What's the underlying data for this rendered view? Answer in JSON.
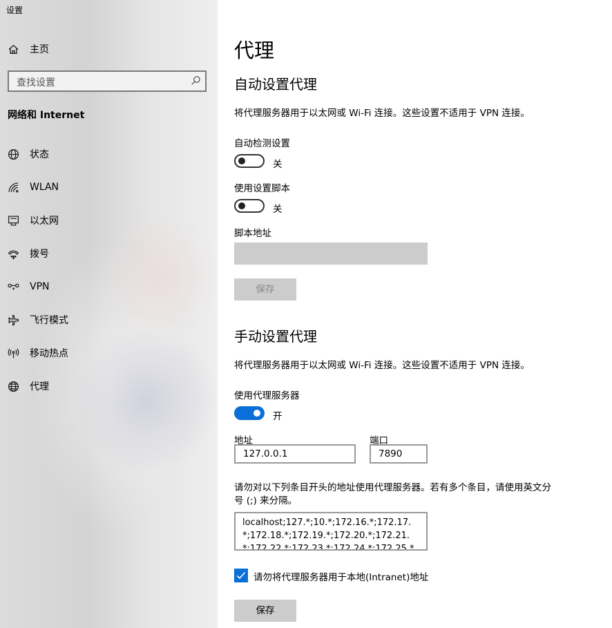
{
  "window": {
    "title": "设置"
  },
  "sidebar": {
    "home_label": "主页",
    "search_placeholder": "查找设置",
    "section_title": "网络和 Internet",
    "items": [
      {
        "label": "状态",
        "icon": "globe-status-icon"
      },
      {
        "label": "WLAN",
        "icon": "wifi-icon"
      },
      {
        "label": "以太网",
        "icon": "ethernet-icon"
      },
      {
        "label": "拨号",
        "icon": "dialup-icon"
      },
      {
        "label": "VPN",
        "icon": "vpn-icon"
      },
      {
        "label": "飞行模式",
        "icon": "airplane-icon"
      },
      {
        "label": "移动热点",
        "icon": "hotspot-icon"
      },
      {
        "label": "代理",
        "icon": "globe-icon"
      }
    ]
  },
  "main": {
    "title": "代理",
    "auto": {
      "heading": "自动设置代理",
      "description": "将代理服务器用于以太网或 Wi-Fi 连接。这些设置不适用于 VPN 连接。",
      "detect_label": "自动检测设置",
      "detect_state": "关",
      "script_label": "使用设置脚本",
      "script_state": "关",
      "script_address_label": "脚本地址",
      "save_label": "保存"
    },
    "manual": {
      "heading": "手动设置代理",
      "description": "将代理服务器用于以太网或 Wi-Fi 连接。这些设置不适用于 VPN 连接。",
      "use_proxy_label": "使用代理服务器",
      "use_proxy_state": "开",
      "address_label": "地址",
      "address_value": "127.0.0.1",
      "port_label": "端口",
      "port_value": "7890",
      "exceptions_desc": "请勿对以下列条目开头的地址使用代理服务器。若有多个条目，请使用英文分号 (;) 来分隔。",
      "exceptions_value": "localhost;127.*;10.*;172.16.*;172.17.*;172.18.*;172.19.*;172.20.*;172.21.*;172.22.*;172.23.*;172.24.*;172.25.*",
      "local_checkbox_label": "请勿将代理服务器用于本地(Intranet)地址",
      "local_checkbox_checked": true,
      "save_label": "保存"
    }
  },
  "colors": {
    "accent": "#0a6fd6",
    "disabled": "#cccccc"
  }
}
